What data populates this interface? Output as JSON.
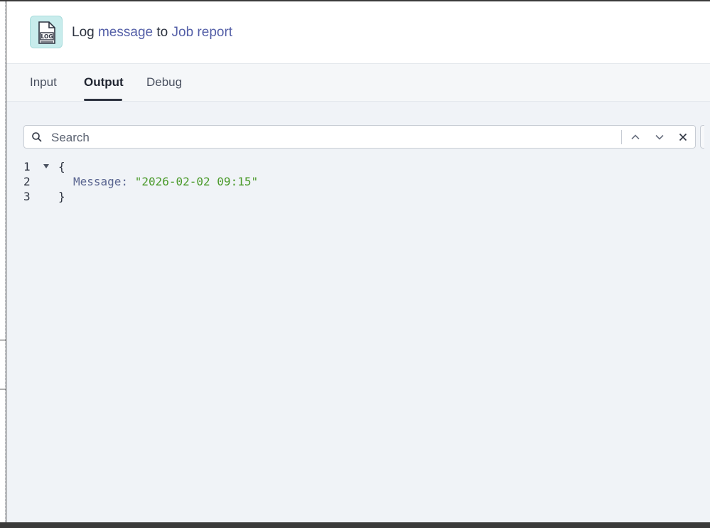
{
  "header": {
    "title_prefix": "Log",
    "title_link1": "message",
    "title_middle": "to",
    "title_link2": "Job report",
    "icon_label": "LOG"
  },
  "tabs": [
    {
      "label": "Input",
      "active": false
    },
    {
      "label": "Output",
      "active": true
    },
    {
      "label": "Debug",
      "active": false
    }
  ],
  "search": {
    "placeholder": "Search",
    "value": ""
  },
  "code": {
    "lines": [
      {
        "num": "1",
        "text": "{"
      },
      {
        "num": "2",
        "key": "Message: ",
        "value": "\"2026-02-02 09:15\""
      },
      {
        "num": "3",
        "text": "}"
      }
    ]
  },
  "colors": {
    "accent_link": "#5560a8",
    "icon_bg": "#c8ecec",
    "string": "#4a9a2a"
  }
}
